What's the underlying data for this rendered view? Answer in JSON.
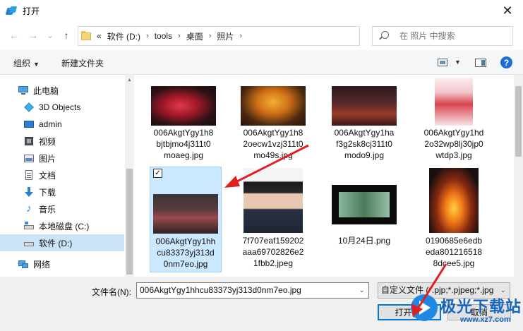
{
  "window": {
    "title": "打开",
    "close_glyph": "✕"
  },
  "nav": {
    "back_glyph": "←",
    "forward_glyph": "→",
    "recent_glyph": "⌄",
    "up_glyph": "↑",
    "breadcrumb": [
      {
        "label": "«"
      },
      {
        "label": "软件 (D:)"
      },
      {
        "label": "tools"
      },
      {
        "label": "桌面"
      },
      {
        "label": "照片"
      }
    ],
    "separator_glyph": "›",
    "dropdown_glyph": "⌄",
    "refresh_glyph": "↻",
    "search_placeholder": "在 照片 中搜索"
  },
  "toolbar": {
    "organize": "组织",
    "organize_caret": "▼",
    "new_folder": "新建文件夹",
    "view_caret": "▼",
    "help": "?"
  },
  "sidebar": {
    "items": [
      {
        "label": "此电脑",
        "icon": "computer-icon"
      },
      {
        "label": "3D Objects",
        "icon": "3d-objects-icon"
      },
      {
        "label": "admin",
        "icon": "desktop-icon"
      },
      {
        "label": "视频",
        "icon": "video-icon"
      },
      {
        "label": "图片",
        "icon": "pictures-icon"
      },
      {
        "label": "文档",
        "icon": "documents-icon"
      },
      {
        "label": "下载",
        "icon": "download-icon"
      },
      {
        "label": "音乐",
        "icon": "music-icon"
      },
      {
        "label": "本地磁盘 (C:)",
        "icon": "drive-c-icon"
      },
      {
        "label": "软件 (D:)",
        "icon": "drive-d-icon",
        "selected": true
      },
      {
        "label": "网络",
        "icon": "network-icon"
      }
    ]
  },
  "files": [
    {
      "name": "006AkgtYgy1h8bjtbjmo4j311t0moaeg.jpg",
      "lines": [
        "006AkgtYgy1h8",
        "bjtbjmo4j311t0",
        "moaeg.jpg"
      ],
      "thumb": "red-dragon"
    },
    {
      "name": "006AkgtYgy1h82oecw1vzj311t0mo49s.jpg",
      "lines": [
        "006AkgtYgy1h8",
        "2oecw1vzj311t0",
        "mo49s.jpg"
      ],
      "thumb": "autumn-tree"
    },
    {
      "name": "006AkgtYgy1haf3g2sk8cj311t0modo9.jpg",
      "lines": [
        "006AkgtYgy1ha",
        "f3g2sk8cj311t0",
        "modo9.jpg"
      ],
      "thumb": "night-street"
    },
    {
      "name": "006AkgtYgy1hd2o32wp8lj30jp0wtdp3.jpg",
      "lines": [
        "006AkgtYgy1hd",
        "2o32wp8lj30jp0",
        "wtdp3.jpg"
      ],
      "thumb": "red-costume"
    },
    {
      "name": "006AkgtYgy1hhcu83373yj313d0nm7eo.jpg",
      "lines": [
        "006AkgtYgy1hh",
        "cu83373yj313d",
        "0nm7eo.jpg"
      ],
      "thumb": "stage-crowd",
      "selected": true
    },
    {
      "name": "7f707eaf159202aaa69702826e21fbb2.jpeg",
      "lines": [
        "7f707eaf159202",
        "aaa69702826e2",
        "1fbb2.jpeg"
      ],
      "thumb": "portrait"
    },
    {
      "name": "10月24日.png",
      "lines": [
        "10月24日.png"
      ],
      "thumb": "green-scene"
    },
    {
      "name": "0190685e6edbeda8012165188dcee5.jpg",
      "lines": [
        "0190685e6edb",
        "eda801216518",
        "8dcee5.jpg"
      ],
      "thumb": "campfire"
    }
  ],
  "checkbox_glyph": "✓",
  "bottom": {
    "filename_label": "文件名(N):",
    "filename_value": "006AkgtYgy1hhcu83373yj313d0nm7eo.jpg",
    "filetype_value": "自定义文件 (*.pjp;*.pjpeg;*.jpg",
    "open_button": "打开(O)",
    "cancel_button": "取消",
    "dropdown_glyph": "⌄"
  },
  "watermark": {
    "text": "极光下载站",
    "url": "www.xz7.com"
  },
  "colors": {
    "selection": "#cce8ff",
    "selection_border": "#99d1ff",
    "accent": "#0078d7",
    "annotation_arrow": "#e02020"
  }
}
